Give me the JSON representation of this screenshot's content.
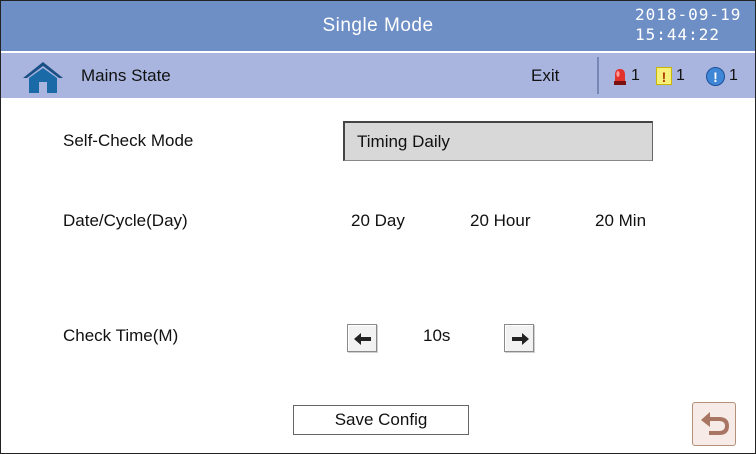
{
  "header": {
    "title": "Single Mode",
    "date": "2018-09-19",
    "time": "15:44:22"
  },
  "status": {
    "home_icon": "home-icon",
    "state_label": "Mains State",
    "exit_label": "Exit",
    "alarms": [
      {
        "icon": "red-alarm-icon",
        "count": "1"
      },
      {
        "icon": "yellow-warning-icon",
        "symbol": "!",
        "count": "1"
      },
      {
        "icon": "blue-info-icon",
        "symbol": "!",
        "count": "1"
      }
    ]
  },
  "form": {
    "self_check_label": "Self-Check Mode",
    "self_check_value": "Timing Daily",
    "date_cycle_label": "Date/Cycle(Day)",
    "day_value": "20 Day",
    "hour_value": "20 Hour",
    "min_value": "20 Min",
    "check_time_label": "Check Time(M)",
    "check_time_value": "10s",
    "decrease_icon": "arrow-left-icon",
    "increase_icon": "arrow-right-icon"
  },
  "footer": {
    "save_label": "Save Config",
    "back_icon": "back-icon"
  },
  "colors": {
    "title_bar": "#6e8fc5",
    "status_bar": "#a9b5df",
    "select_bg": "#d8d8d8"
  }
}
